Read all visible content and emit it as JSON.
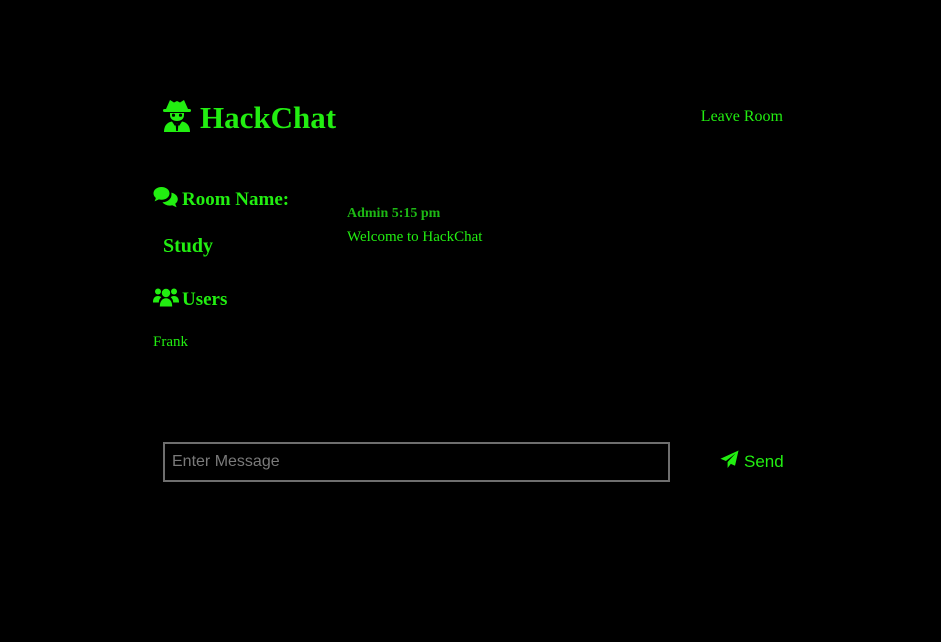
{
  "header": {
    "brand_title": "HackChat",
    "brand_icon": "user-secret-icon",
    "leave_room_label": "Leave Room"
  },
  "sidebar": {
    "room_heading": "Room Name:",
    "room_heading_icon": "comments-icon",
    "room_name": "Study",
    "users_heading": "Users",
    "users_heading_icon": "users-icon",
    "users": [
      "Frank"
    ]
  },
  "messages": [
    {
      "author": "Admin",
      "time": "5:15 pm",
      "text": "Welcome to HackChat"
    }
  ],
  "composer": {
    "placeholder": "Enter Message",
    "value": "",
    "send_label": "Send",
    "send_icon": "paper-plane-icon"
  },
  "colors": {
    "background": "#000000",
    "accent": "#22ee11",
    "meta": "#1db814",
    "input_border": "#6e6e6e"
  }
}
